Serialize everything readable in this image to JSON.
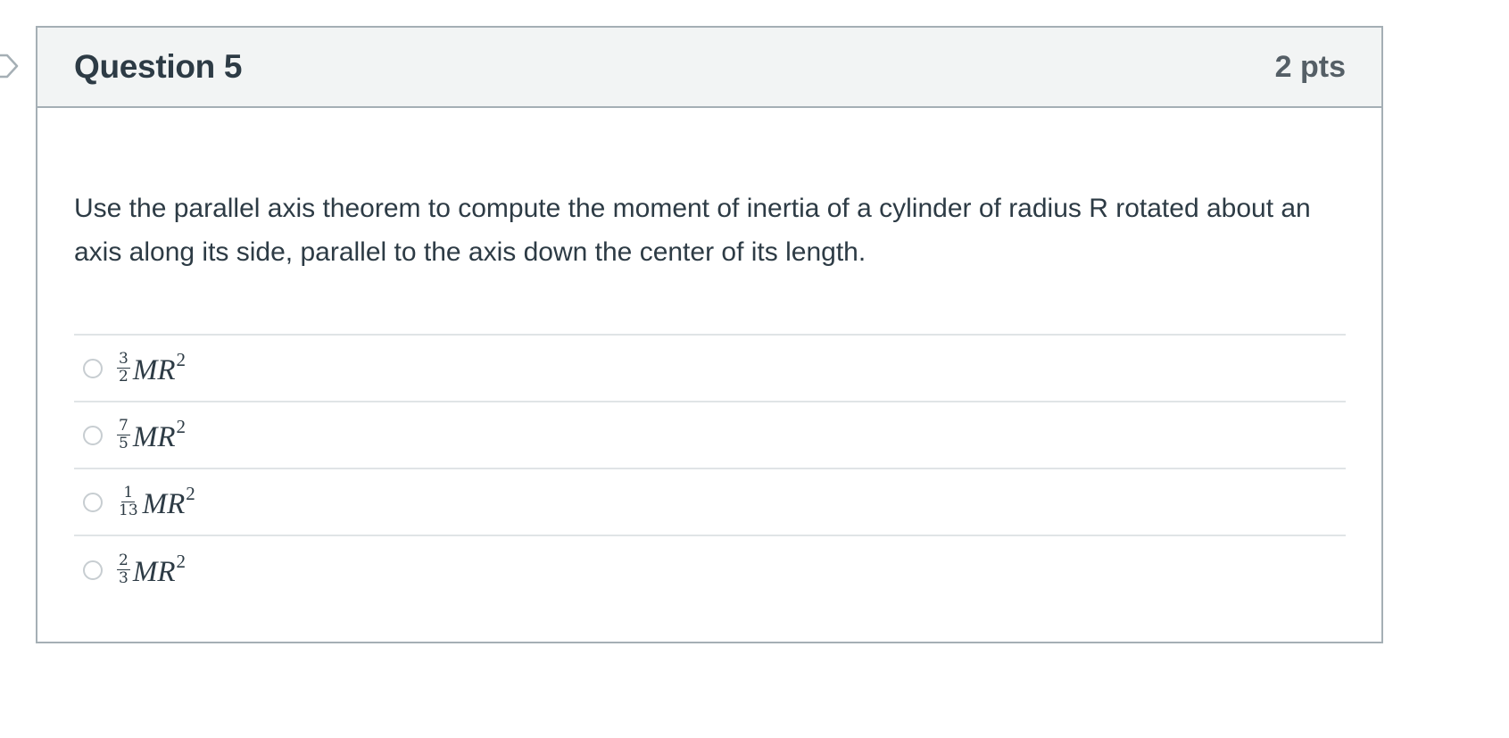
{
  "question": {
    "title": "Question 5",
    "points": "2 pts",
    "text": "Use the parallel axis theorem to compute the moment of inertia of a cylinder of radius R rotated about an axis along its side, parallel to the axis down the center of its length."
  },
  "answers": [
    {
      "numerator": "3",
      "denominator": "2",
      "expression": "MR",
      "exponent": "2"
    },
    {
      "numerator": "7",
      "denominator": "5",
      "expression": "MR",
      "exponent": "2"
    },
    {
      "numerator": "1",
      "denominator": "13",
      "expression": "MR",
      "exponent": "2"
    },
    {
      "numerator": "2",
      "denominator": "3",
      "expression": "MR",
      "exponent": "2"
    }
  ],
  "colors": {
    "header_background": "#f2f4f4",
    "border": "#a5afb5",
    "text": "#2d3b45",
    "divider": "#e0e4e6"
  },
  "icons": {
    "flag_marker": "flag-outline-icon",
    "radio": "radio-unselected-icon"
  }
}
